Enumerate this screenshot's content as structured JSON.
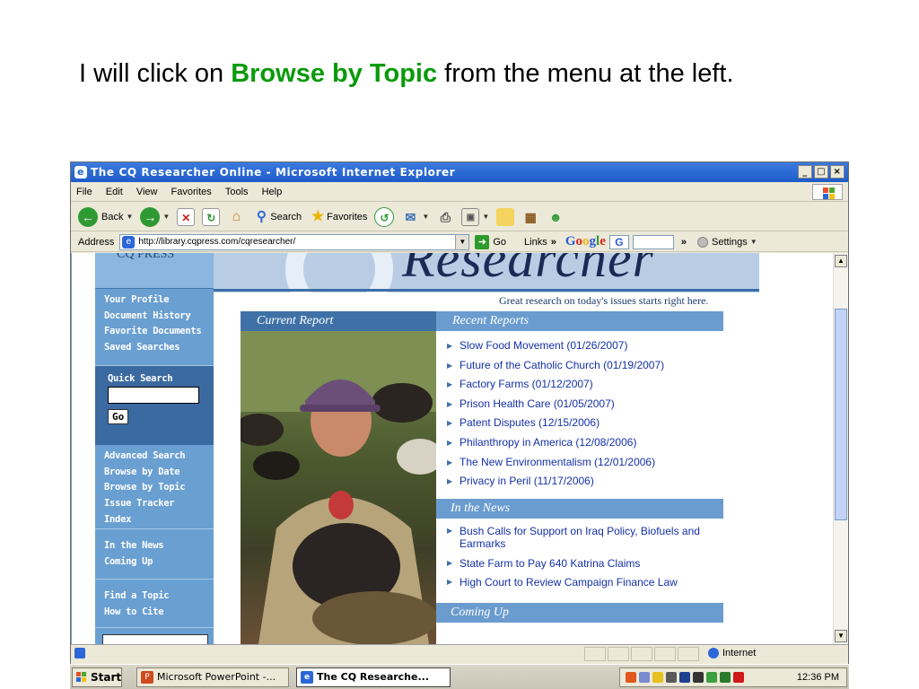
{
  "caption": {
    "before": "I will click on ",
    "highlight": "Browse by Topic",
    "after": " from the menu at the left."
  },
  "window": {
    "title": "The CQ Researcher Online - Microsoft Internet Explorer",
    "controls": [
      "_",
      "□",
      "×"
    ]
  },
  "menubar": [
    "File",
    "Edit",
    "View",
    "Favorites",
    "Tools",
    "Help"
  ],
  "toolbar": {
    "back": "Back",
    "search": "Search",
    "favorites": "Favorites"
  },
  "addressbar": {
    "label": "Address",
    "url": "http://library.cqpress.com/cqresearcher/",
    "go": "Go",
    "links": "Links",
    "links_chevron": "»",
    "google": "Google",
    "google_g": "G",
    "more_chevron": "»",
    "settings": "Settings"
  },
  "site": {
    "tagline": "Great research on today's issues starts right here.",
    "banner_text": "Researcher",
    "nav_top": [
      "Your Profile",
      "Document History",
      "Favorite Documents",
      "Saved Searches"
    ],
    "quick_search_label": "Quick Search",
    "go_label": "Go",
    "nav_mid": [
      "Advanced Search",
      "Browse by Date",
      "Browse by Topic",
      "Issue Tracker",
      "Index"
    ],
    "nav_news": [
      "In the News",
      "Coming Up"
    ],
    "nav_find": [
      "Find a Topic",
      "How to Cite"
    ],
    "current_report_head": "Current Report",
    "recent_reports_head": "Recent Reports",
    "recent_reports": [
      "Slow Food Movement (01/26/2007)",
      "Future of the Catholic Church (01/19/2007)",
      "Factory Farms (01/12/2007)",
      "Prison Health Care (01/05/2007)",
      "Patent Disputes (12/15/2006)",
      "Philanthropy in America (12/08/2006)",
      "The New Environmentalism (12/01/2006)",
      "Privacy in Peril (11/17/2006)"
    ],
    "in_the_news_head": "In the News",
    "in_the_news": [
      "Bush Calls for Support on Iraq Policy, Biofuels and Earmarks",
      "State Farm to Pay 640 Katrina Claims",
      "High Court to Review Campaign Finance Law"
    ],
    "coming_up_head": "Coming Up"
  },
  "statusbar": {
    "zone": "Internet"
  },
  "taskbar": {
    "start": "Start",
    "items": [
      "Microsoft PowerPoint -...",
      "The CQ Researche..."
    ],
    "clock": "12:36 PM"
  },
  "colors": {
    "highlight_green": "#0a9a0a",
    "nav_blue": "#6a9fd1",
    "header_blue": "#3f71a7",
    "link_blue": "#1530a8"
  }
}
